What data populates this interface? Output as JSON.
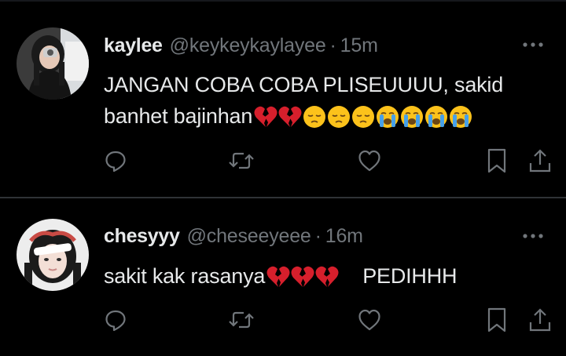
{
  "theme": {
    "background": "#000000",
    "text": "#e7e9ea",
    "muted": "#71767b",
    "divider": "#2f3336"
  },
  "tweets": [
    {
      "name": "kaylee",
      "handle": "@keykeykaylayee",
      "separator": "·",
      "time": "15m",
      "text_line1": "JANGAN COBA COBA PLISEUUUU, sakid",
      "text_line2": "banhet bajinhan",
      "emojis": [
        "broken-heart",
        "broken-heart",
        "pensive-face",
        "pensive-face",
        "pensive-face",
        "loudly-crying-face",
        "loudly-crying-face",
        "loudly-crying-face",
        "loudly-crying-face"
      ],
      "icons": [
        "reply-icon",
        "retweet-icon",
        "like-icon",
        "bookmark-icon",
        "share-icon"
      ]
    },
    {
      "name": "chesyyy",
      "handle": "@cheseeyeee",
      "separator": "·",
      "time": "16m",
      "text_prefix": "sakit kak rasanya",
      "text_suffix": "PEDIHHH",
      "emojis": [
        "broken-heart",
        "broken-heart",
        "broken-heart"
      ],
      "icons": [
        "reply-icon",
        "retweet-icon",
        "like-icon",
        "bookmark-icon",
        "share-icon"
      ]
    }
  ]
}
